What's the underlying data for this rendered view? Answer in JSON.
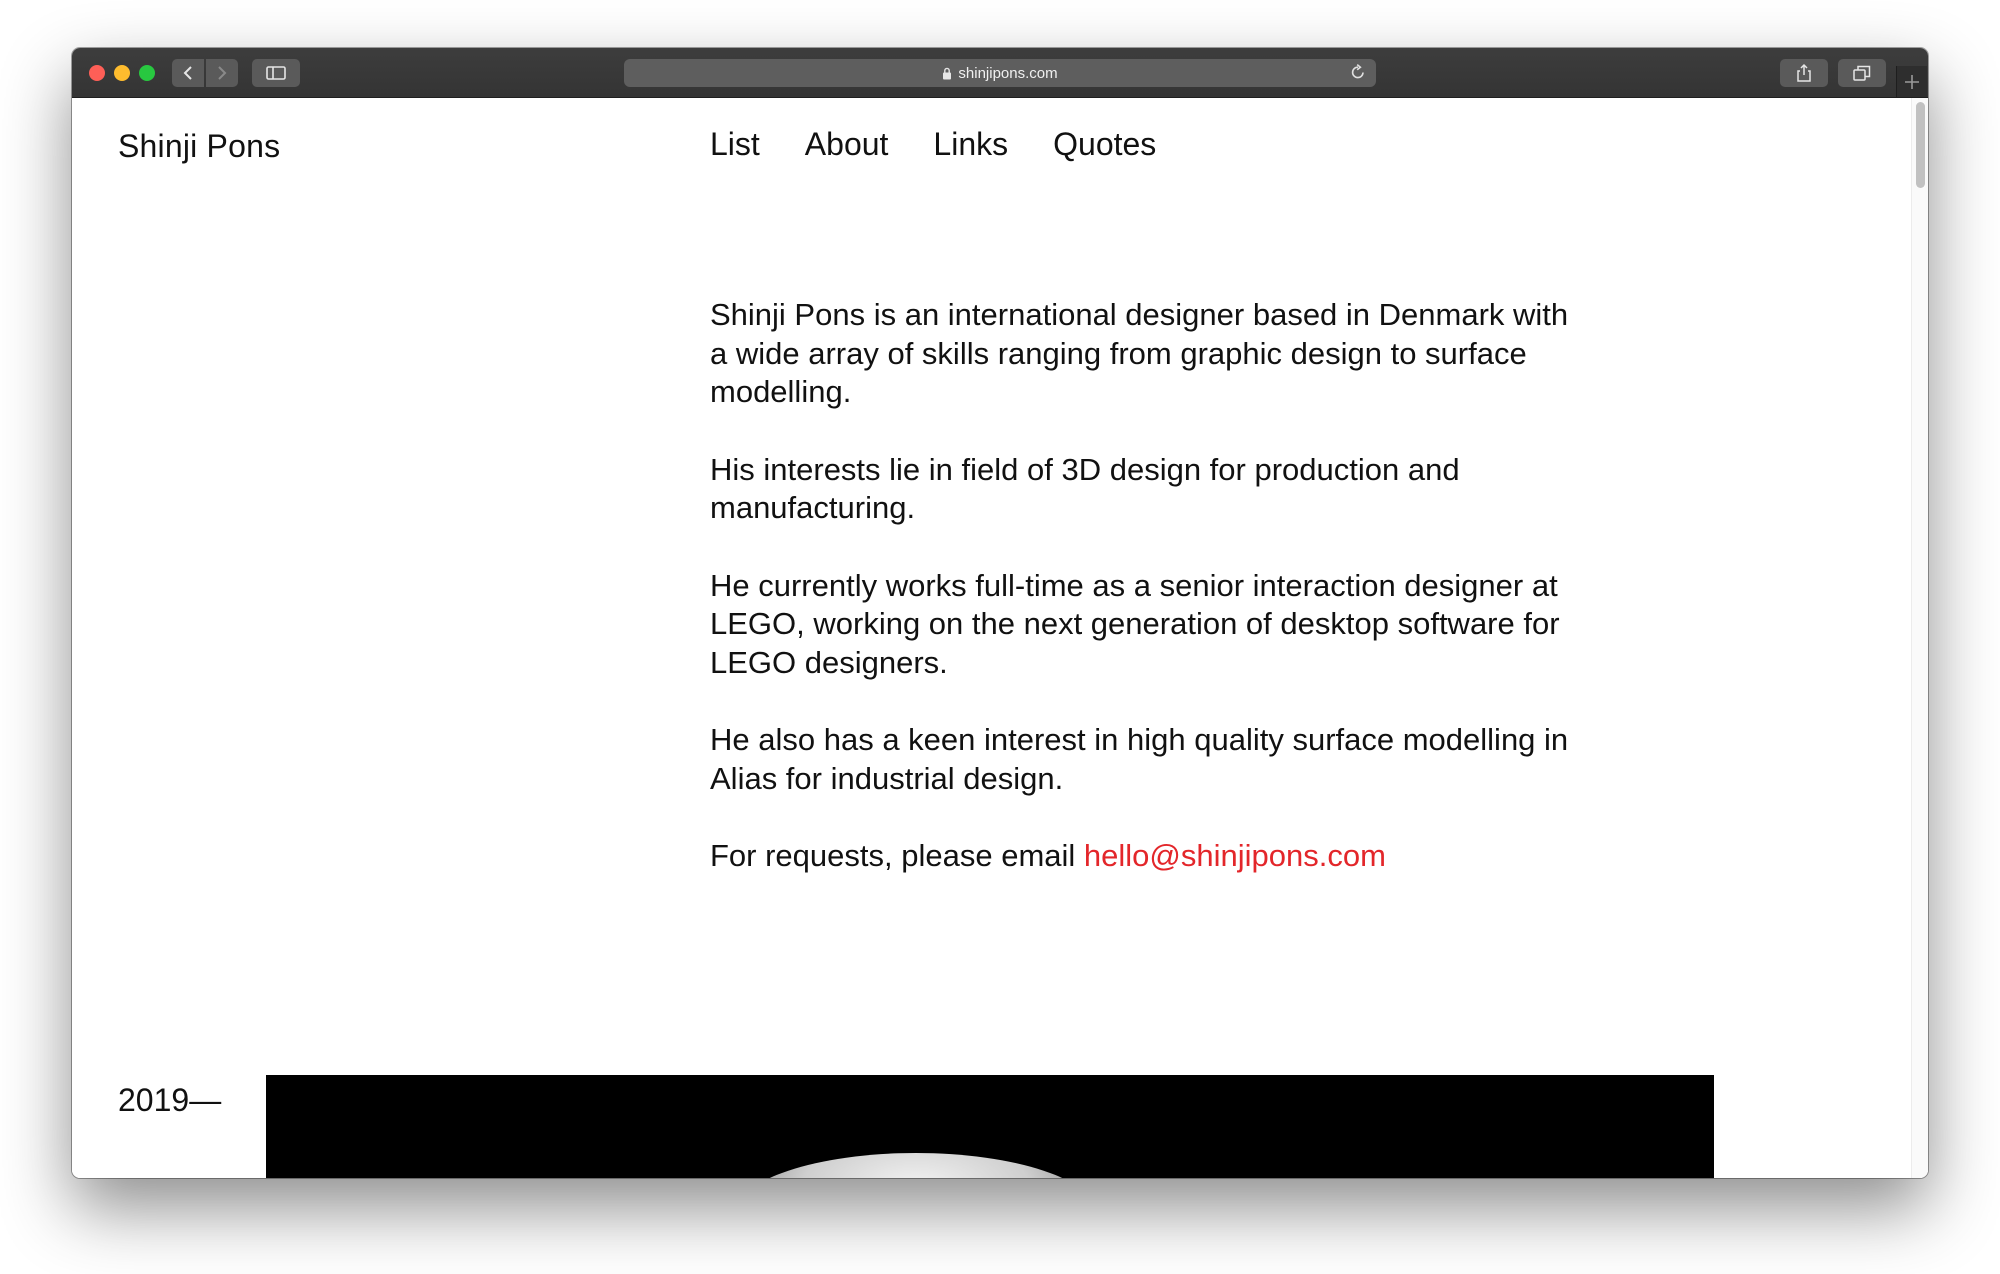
{
  "browser": {
    "url": "shinjipons.com",
    "icons": {
      "back": "chevron-left-icon",
      "forward": "chevron-right-icon",
      "sidebar": "sidebar-icon",
      "lock": "lock-icon",
      "reload": "reload-icon",
      "share": "share-icon",
      "tabs": "tabs-overview-icon",
      "new_tab": "plus-icon"
    }
  },
  "site": {
    "logo": "Shinji Pons",
    "nav": [
      "List",
      "About",
      "Links",
      "Quotes"
    ],
    "bio": {
      "p1": "Shinji Pons is an international designer based in Denmark with a wide array of skills ranging from graphic design to surface modelling.",
      "p2": "His interests lie in field of 3D design for production and manufacturing.",
      "p3": "He currently works full-time as a senior interaction designer at LEGO, working on the next generation of desktop software for LEGO designers.",
      "p4": "He also has a keen interest in high quality surface modelling in Alias for industrial design.",
      "p5_prefix": "For requests, please email ",
      "email": "hello@shinjipons.com"
    },
    "year": "2019—",
    "colors": {
      "link_accent": "#e3262a",
      "text": "#111111",
      "image_bg": "#000000"
    }
  }
}
